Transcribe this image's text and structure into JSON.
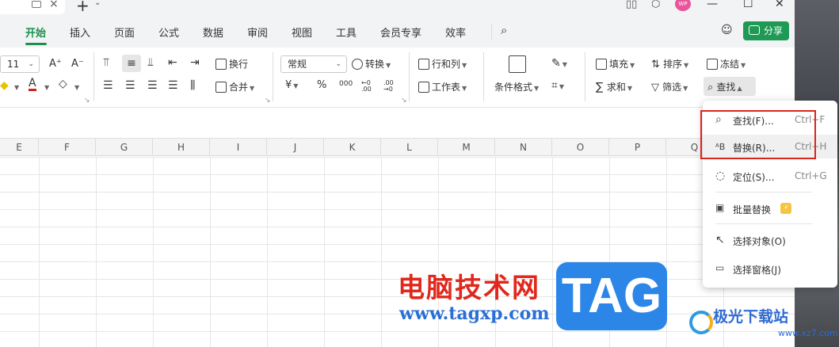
{
  "titlebar": {
    "close_glyph": "×",
    "plus_glyph": "+",
    "avatar_text": "WP"
  },
  "menu": {
    "items": [
      "开始",
      "插入",
      "页面",
      "公式",
      "数据",
      "审阅",
      "视图",
      "工具",
      "会员专享",
      "效率"
    ],
    "active": "开始",
    "share_label": "分享"
  },
  "ribbon": {
    "font_size": "11",
    "wrap_label": "换行",
    "merge_label": "合并",
    "number_format": "常规",
    "convert_label": "转换",
    "row_col_label": "行和列",
    "worksheet_label": "工作表",
    "cond_format_label": "条件格式",
    "fill_label": "填充",
    "sort_label": "排序",
    "freeze_label": "冻结",
    "sum_label": "求和",
    "filter_label": "筛选",
    "find_label": "查找",
    "currency_glyph": "¥",
    "percent_glyph": "%",
    "thousands_glyph": "000",
    "inc_dec_glyph": "←0 .00",
    "dec_dec_glyph": ".00 →0"
  },
  "columns": [
    "E",
    "F",
    "G",
    "H",
    "I",
    "J",
    "K",
    "L",
    "M",
    "N",
    "O",
    "P",
    "Q"
  ],
  "find_menu": {
    "items": [
      {
        "label": "查找(F)...",
        "shortcut": "Ctrl+F",
        "icon": "search-icon"
      },
      {
        "label": "替换(R)...",
        "shortcut": "Ctrl+H",
        "icon": "replace-icon"
      },
      {
        "label": "定位(S)...",
        "shortcut": "Ctrl+G",
        "icon": "goto-icon"
      },
      {
        "label": "批量替换",
        "shortcut": "",
        "icon": "batch-replace-icon"
      },
      {
        "label": "选择对象(O)",
        "shortcut": "",
        "icon": "select-object-icon"
      },
      {
        "label": "选择窗格(J)",
        "shortcut": "",
        "icon": "selection-pane-icon"
      }
    ]
  },
  "watermark": {
    "cn_text": "电脑技术网",
    "url_text": "www.tagxp.com",
    "tag_text": "TAG",
    "logo_text": "极光下载站",
    "logo_sub": "www.xz7.com"
  },
  "colors": {
    "accent": "#1f8f4e",
    "share_bg": "#1f9a55",
    "highlight_box": "#d9261c"
  }
}
